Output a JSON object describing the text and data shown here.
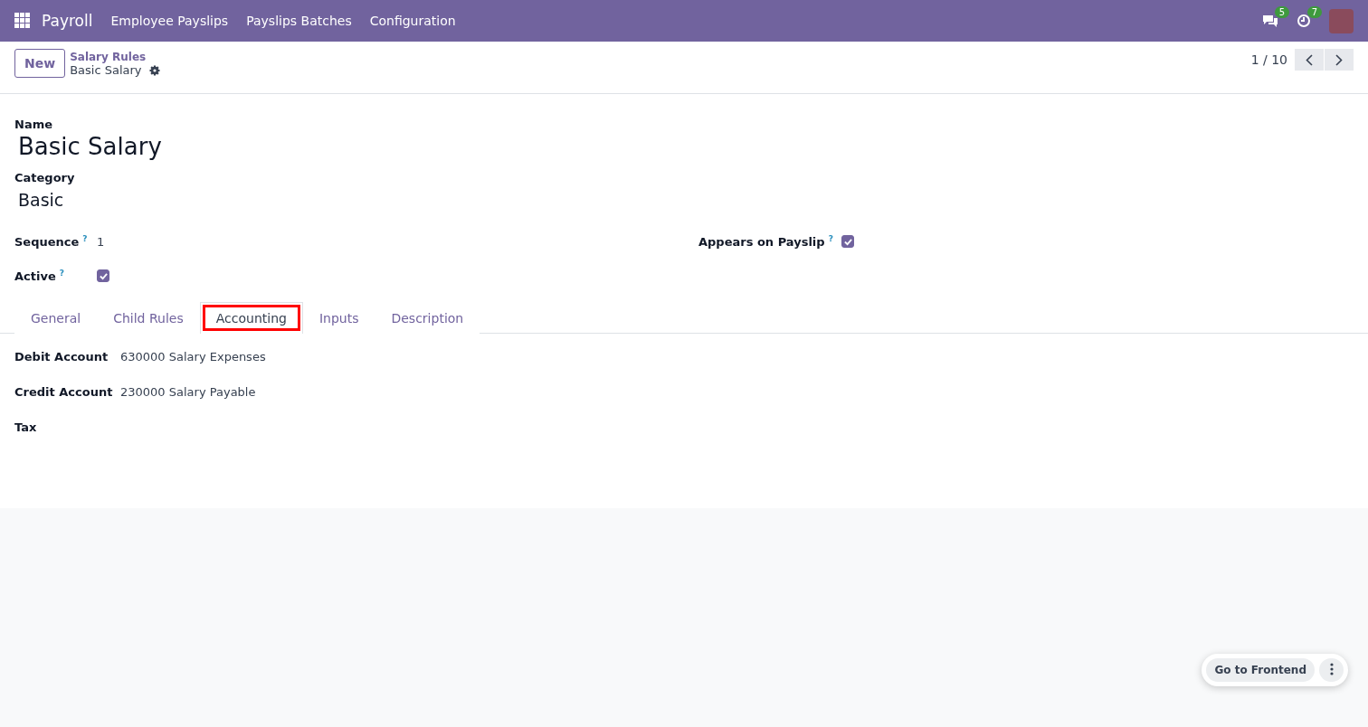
{
  "navbar": {
    "app": "Payroll",
    "menu": [
      "Employee Payslips",
      "Payslips Batches",
      "Configuration"
    ],
    "messages_count": "5",
    "activities_count": "7"
  },
  "control_panel": {
    "new_button": "New",
    "breadcrumb": "Salary Rules",
    "record": "Basic Salary",
    "pager": "1 / 10"
  },
  "form": {
    "name_label": "Name",
    "name": "Basic Salary",
    "category_label": "Category",
    "category": "Basic",
    "sequence_label": "Sequence",
    "sequence_help": "?",
    "sequence": "1",
    "active_label": "Active",
    "active_help": "?",
    "active": true,
    "payslip_label": "Appears on Payslip",
    "payslip_help": "?",
    "appears_on_payslip": true
  },
  "tabs": [
    {
      "label": "General",
      "selected": false,
      "highlighted": false
    },
    {
      "label": "Child Rules",
      "selected": false,
      "highlighted": false
    },
    {
      "label": "Accounting",
      "selected": true,
      "highlighted": true
    },
    {
      "label": "Inputs",
      "selected": false,
      "highlighted": false
    },
    {
      "label": "Description",
      "selected": false,
      "highlighted": false
    }
  ],
  "accounting": [
    {
      "label": "Debit Account",
      "value": "630000 Salary Expenses"
    },
    {
      "label": "Credit Account",
      "value": "230000 Salary Payable"
    },
    {
      "label": "Tax"
    }
  ],
  "floating": {
    "button": "Go to Frontend"
  }
}
